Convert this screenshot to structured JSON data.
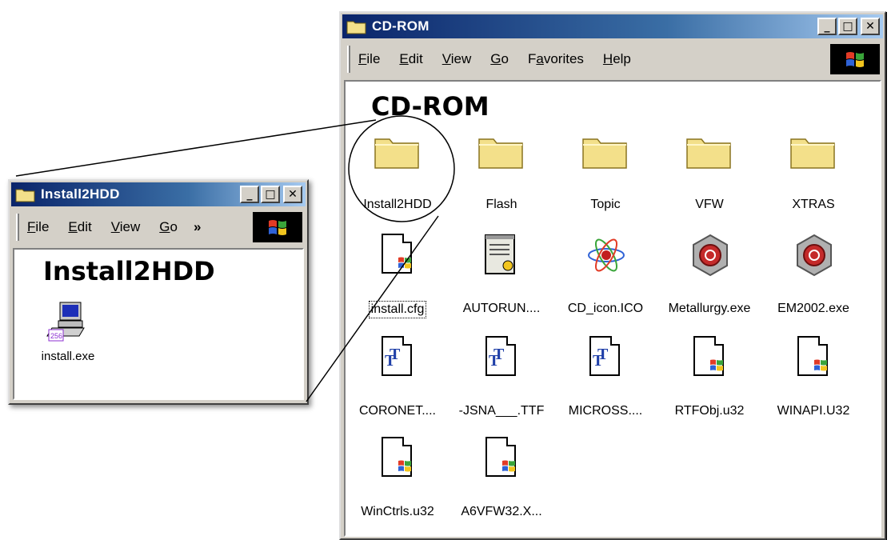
{
  "cd_window": {
    "title": "CD-ROM",
    "heading": "CD-ROM",
    "menu": [
      {
        "label": "File",
        "key": "F",
        "rest": "ile"
      },
      {
        "label": "Edit",
        "key": "E",
        "rest": "dit"
      },
      {
        "label": "View",
        "key": "V",
        "rest": "iew"
      },
      {
        "label": "Go",
        "key": "G",
        "rest": "o"
      },
      {
        "label": "Favorites",
        "key": "a",
        "pre": "F",
        "rest": "vorites"
      },
      {
        "label": "Help",
        "key": "H",
        "rest": "elp"
      }
    ],
    "items": [
      {
        "label": "Install2HDD",
        "icon": "folder-icon"
      },
      {
        "label": "Flash",
        "icon": "folder-icon"
      },
      {
        "label": "Topic",
        "icon": "folder-icon"
      },
      {
        "label": "VFW",
        "icon": "folder-icon"
      },
      {
        "label": "XTRAS",
        "icon": "folder-icon"
      },
      {
        "label": "install.cfg",
        "icon": "config-file-icon"
      },
      {
        "label": "AUTORUN....",
        "icon": "setup-info-icon"
      },
      {
        "label": "CD_icon.ICO",
        "icon": "atom-icon"
      },
      {
        "label": "Metallurgy.exe",
        "icon": "program-icon"
      },
      {
        "label": "EM2002.exe",
        "icon": "program-icon"
      },
      {
        "label": "CORONET....",
        "icon": "font-file-icon"
      },
      {
        "label": "-JSNA___.TTF",
        "icon": "font-file-icon"
      },
      {
        "label": "MICROSS....",
        "icon": "font-file-icon"
      },
      {
        "label": "RTFObj.u32",
        "icon": "system-file-icon"
      },
      {
        "label": "WINAPI.U32",
        "icon": "system-file-icon"
      },
      {
        "label": "WinCtrls.u32",
        "icon": "system-file-icon"
      },
      {
        "label": "A6VFW32.X...",
        "icon": "system-file-icon"
      }
    ]
  },
  "sub_window": {
    "title": "Install2HDD",
    "heading": "Install2HDD",
    "menu": [
      {
        "label": "File",
        "key": "F",
        "rest": "ile"
      },
      {
        "label": "Edit",
        "key": "E",
        "rest": "dit"
      },
      {
        "label": "View",
        "key": "V",
        "rest": "iew"
      },
      {
        "label": "Go",
        "key": "G",
        "rest": "o"
      }
    ],
    "chevron": "»",
    "items": [
      {
        "label": "install.exe",
        "icon": "installer-computer-icon"
      }
    ]
  },
  "colors": {
    "title_start": "#0a246a",
    "title_end": "#a6caf0",
    "folder": "#f3e08a",
    "chrome": "#d4d0c8"
  }
}
